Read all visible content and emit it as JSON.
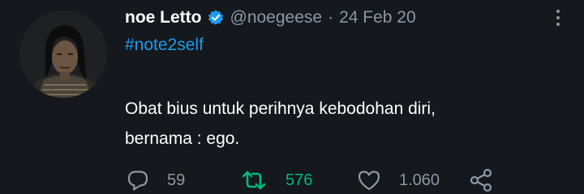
{
  "tweet": {
    "author_name": "noe Letto",
    "handle": "@noegeese",
    "separator": "·",
    "date": "24 Feb 20",
    "hashtag": "#note2self",
    "text_lines": [
      "Obat bius untuk perihnya kebodohan diri,",
      "bernama : ego."
    ],
    "reply_count": "59",
    "retweet_count": "576",
    "like_count": "1.060"
  },
  "colors": {
    "background": "#15181c",
    "text": "#ffffff",
    "muted": "#8b98a5",
    "link": "#1d9bf0",
    "retweet_active": "#00ba7c"
  },
  "icons": {
    "verified": "verified-badge-icon",
    "more": "more-dots-icon",
    "reply": "reply-bubble-icon",
    "retweet": "retweet-icon",
    "like": "heart-icon",
    "share": "share-icon"
  }
}
